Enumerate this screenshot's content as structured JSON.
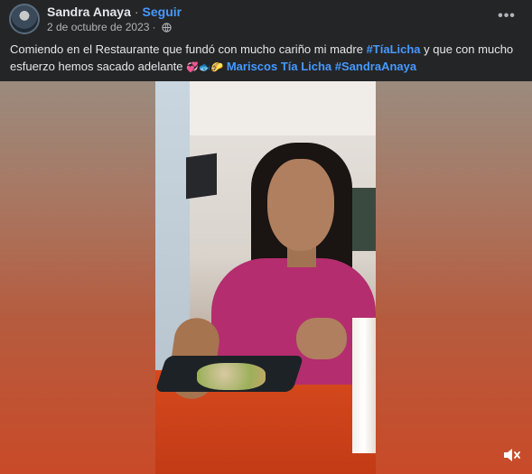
{
  "post": {
    "author_name": "Sandra Anaya",
    "separator": "·",
    "follow_label": "Seguir",
    "date": "2 de octubre de 2023",
    "date_separator": "·",
    "more_label": "•••",
    "caption": {
      "text_before": "Comiendo en el Restaurante que fundó con mucho cariño mi madre ",
      "hashtag_1": "#TíaLicha",
      "text_middle": " y que con mucho esfuerzo hemos sacado adelante ",
      "emojis": "💞🐟🌮",
      "mention": " Mariscos Tía Licha",
      "hashtag_2": " #SandraAnaya"
    },
    "icons": {
      "avatar": "avatar-image",
      "privacy": "globe-icon",
      "more": "more-options-icon",
      "mute": "speaker-muted-icon"
    },
    "colors": {
      "background": "#242526",
      "text": "#e4e6eb",
      "secondary_text": "#b0b3b8",
      "link": "#4599ff"
    }
  }
}
